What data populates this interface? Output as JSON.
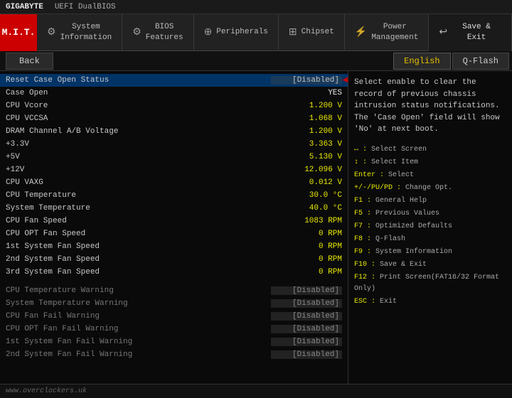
{
  "topbar": {
    "logo": "GIGABYTE",
    "title": "UEFI DualBIOS"
  },
  "nav": {
    "mit_label": "M.I.T.",
    "items": [
      {
        "id": "system-info",
        "icon": "⚙",
        "label": "System\nInformation",
        "active": false
      },
      {
        "id": "bios-features",
        "icon": "⚙",
        "label": "BIOS\nFeatures",
        "active": false
      },
      {
        "id": "peripherals",
        "icon": "⊕",
        "label": "Peripherals",
        "active": false
      },
      {
        "id": "chipset",
        "icon": "⊞",
        "label": "Chipset",
        "active": false
      },
      {
        "id": "power-management",
        "icon": "⚡",
        "label": "Power\nManagement",
        "active": false
      }
    ],
    "save_exit_label": "Save & Exit"
  },
  "toolbar": {
    "back_label": "Back",
    "language": "English",
    "qflash_label": "Q-Flash"
  },
  "rows": [
    {
      "label": "Reset Case Open Status",
      "value": "[Disabled]",
      "type": "bracketed",
      "selected": true
    },
    {
      "label": "Case Open",
      "value": "YES",
      "type": "white"
    },
    {
      "label": "CPU Vcore",
      "value": "1.200 V",
      "type": "yellow"
    },
    {
      "label": "CPU VCCSA",
      "value": "1.068 V",
      "type": "yellow"
    },
    {
      "label": "DRAM Channel A/B Voltage",
      "value": "1.200 V",
      "type": "yellow"
    },
    {
      "label": "+3.3V",
      "value": "3.363 V",
      "type": "yellow"
    },
    {
      "label": "+5V",
      "value": "5.130 V",
      "type": "yellow"
    },
    {
      "label": "+12V",
      "value": "12.096 V",
      "type": "yellow"
    },
    {
      "label": "CPU VAXG",
      "value": "0.012 V",
      "type": "yellow"
    },
    {
      "label": "CPU Temperature",
      "value": "30.0 °C",
      "type": "yellow"
    },
    {
      "label": "System Temperature",
      "value": "40.0 °C",
      "type": "yellow"
    },
    {
      "label": "CPU Fan Speed",
      "value": "1083 RPM",
      "type": "yellow"
    },
    {
      "label": "CPU OPT Fan Speed",
      "value": "0 RPM",
      "type": "yellow"
    },
    {
      "label": "1st System Fan Speed",
      "value": "0 RPM",
      "type": "yellow"
    },
    {
      "label": "2nd System Fan Speed",
      "value": "0 RPM",
      "type": "yellow"
    },
    {
      "label": "3rd System Fan Speed",
      "value": "0 RPM",
      "type": "yellow"
    },
    {
      "spacer": true
    },
    {
      "label": "CPU Temperature Warning",
      "value": "[Disabled]",
      "type": "bracketed-dim"
    },
    {
      "label": "System Temperature Warning",
      "value": "[Disabled]",
      "type": "bracketed-dim"
    },
    {
      "label": "CPU Fan Fail Warning",
      "value": "[Disabled]",
      "type": "bracketed-dim"
    },
    {
      "label": "CPU OPT Fan Fail Warning",
      "value": "[Disabled]",
      "type": "bracketed-dim"
    },
    {
      "label": "1st System Fan Fail Warning",
      "value": "[Disabled]",
      "type": "bracketed-dim"
    },
    {
      "label": "2nd System Fan Fail Warning",
      "value": "[Disabled]",
      "type": "bracketed-dim"
    }
  ],
  "help": {
    "description": "Select enable to clear the record of previous chassis intrusion status notifications. The 'Case Open' field will show 'No' at next boot.",
    "keys": [
      {
        "key": "↔",
        "desc": "Select Screen"
      },
      {
        "key": "↕",
        "desc": "Select Item"
      },
      {
        "key": "Enter",
        "desc": "Select"
      },
      {
        "key": "+/-/PU/PD",
        "desc": "Change Opt."
      },
      {
        "key": "F1",
        "desc": "General Help"
      },
      {
        "key": "F5",
        "desc": "Previous Values"
      },
      {
        "key": "F7",
        "desc": "Optimized Defaults"
      },
      {
        "key": "F8",
        "desc": "Q-Flash"
      },
      {
        "key": "F9",
        "desc": "System Information"
      },
      {
        "key": "F10",
        "desc": "Save & Exit"
      },
      {
        "key": "F12",
        "desc": "Print Screen(FAT16/32 Format Only)"
      },
      {
        "key": "ESC",
        "desc": "Exit"
      }
    ]
  },
  "bottom": {
    "left": "www.overclockers.uk",
    "right": ""
  }
}
